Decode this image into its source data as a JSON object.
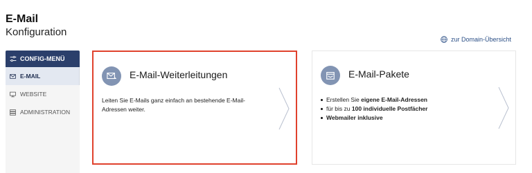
{
  "header": {
    "title": "E-Mail",
    "subtitle": "Konfiguration",
    "domain_link": "zur Domain-Übersicht"
  },
  "sidebar": {
    "header_label": "CONFIG-MENÜ",
    "items": [
      {
        "label": "E-MAIL",
        "icon": "mail-icon",
        "active": true
      },
      {
        "label": "WEBSITE",
        "icon": "monitor-icon",
        "active": false
      },
      {
        "label": "ADMINISTRATION",
        "icon": "server-icon",
        "active": false
      }
    ]
  },
  "cards": {
    "forwarding": {
      "title": "E-Mail-Weiterleitungen",
      "text": "Leiten Sie E-Mails ganz einfach an bestehende E-Mail-Adressen weiter."
    },
    "packages": {
      "title": "E-Mail-Pakete",
      "bullets": [
        {
          "pre": "Erstellen Sie ",
          "bold": "eigene E-Mail-Adressen",
          "post": ""
        },
        {
          "pre": "für bis zu ",
          "bold": "100 individuelle Postfächer",
          "post": ""
        },
        {
          "pre": "",
          "bold": "Webmailer inklusive",
          "post": ""
        }
      ]
    }
  },
  "colors": {
    "accent": "#2b3f6b",
    "selection_border": "#e0412c",
    "icon_circle": "#8294b3"
  }
}
